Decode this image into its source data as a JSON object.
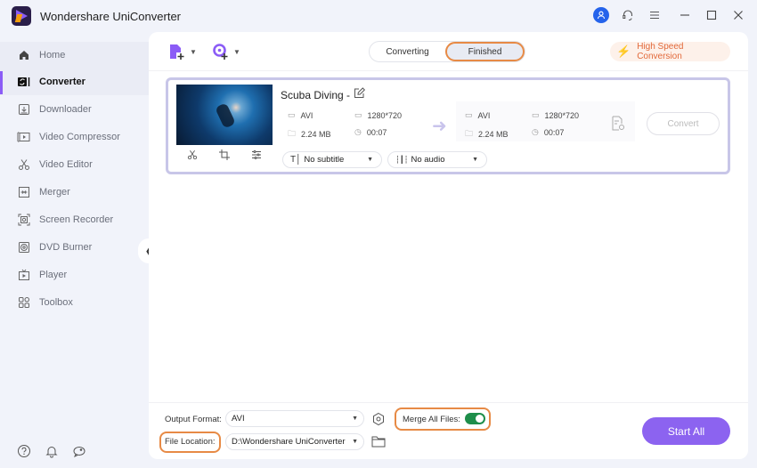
{
  "app": {
    "title": "Wondershare UniConverter"
  },
  "titlebar": {
    "icons": [
      "user-avatar-icon",
      "support-headset-icon",
      "menu-icon",
      "minimize-icon",
      "maximize-icon",
      "close-icon"
    ]
  },
  "sidebar": {
    "items": [
      {
        "label": "Home",
        "icon": "home-icon",
        "active": false
      },
      {
        "label": "Converter",
        "icon": "converter-icon",
        "active": true
      },
      {
        "label": "Downloader",
        "icon": "download-icon",
        "active": false
      },
      {
        "label": "Video Compressor",
        "icon": "compress-icon",
        "active": false
      },
      {
        "label": "Video Editor",
        "icon": "scissors-icon",
        "active": false
      },
      {
        "label": "Merger",
        "icon": "merge-icon",
        "active": false
      },
      {
        "label": "Screen Recorder",
        "icon": "screen-record-icon",
        "active": false
      },
      {
        "label": "DVD Burner",
        "icon": "disc-icon",
        "active": false
      },
      {
        "label": "Player",
        "icon": "player-icon",
        "active": false
      },
      {
        "label": "Toolbox",
        "icon": "toolbox-icon",
        "active": false
      }
    ],
    "bottom_icons": [
      "help-icon",
      "bell-icon",
      "feedback-icon"
    ]
  },
  "toolbar": {
    "tabs": [
      {
        "label": "Converting",
        "selected": false
      },
      {
        "label": "Finished",
        "selected": true
      }
    ],
    "high_speed_label": "High Speed Conversion"
  },
  "file": {
    "name": "Scuba Diving -",
    "source": {
      "format": "AVI",
      "resolution": "1280*720",
      "size": "2.24 MB",
      "duration": "00:07"
    },
    "output": {
      "format": "AVI",
      "resolution": "1280*720",
      "size": "2.24 MB",
      "duration": "00:07"
    },
    "subtitle": "No subtitle",
    "audio": "No audio",
    "convert_label": "Convert"
  },
  "bottom": {
    "output_format_label": "Output Format:",
    "output_format_value": "AVI",
    "file_location_label": "File Location:",
    "file_location_value": "D:\\Wondershare UniConverter",
    "merge_label": "Merge All Files:",
    "merge_enabled": true,
    "start_all_label": "Start All"
  },
  "colors": {
    "accent": "#8c63f0",
    "highlight": "#e78a45",
    "toggle_on": "#1e8e4a",
    "high_speed_text": "#e2693a"
  }
}
